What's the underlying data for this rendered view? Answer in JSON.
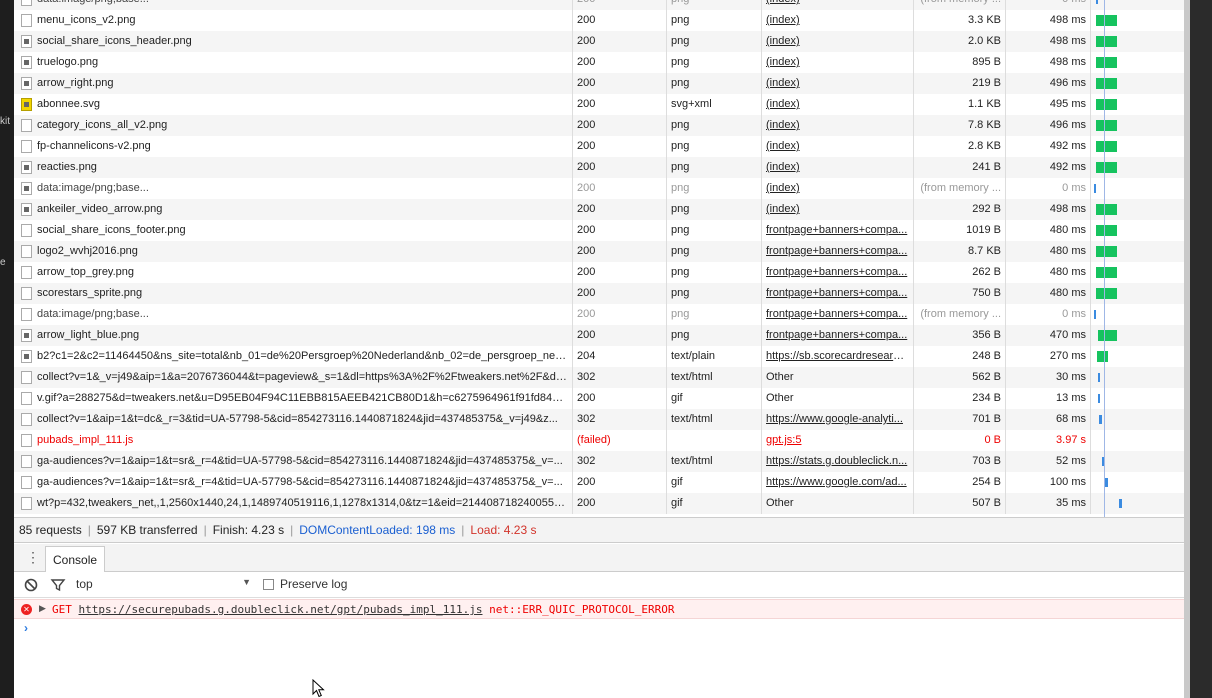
{
  "left_strip": {
    "text_1": "kit",
    "text_2": "e"
  },
  "requests": [
    {
      "name": "data:image/png;base...",
      "status": "200",
      "type": "png",
      "initiator": "(index)",
      "size": "(from memory ...",
      "time": "0 ms",
      "icon": "blank-file-icon",
      "dim": true,
      "wf_start": 5,
      "wf_width": 2
    },
    {
      "name": "menu_icons_v2.png",
      "status": "200",
      "type": "png",
      "initiator": "(index)",
      "size": "3.3 KB",
      "time": "498 ms",
      "icon": "blank-file-icon",
      "dim": false,
      "wf_start": 5,
      "wf_width": 21
    },
    {
      "name": "social_share_icons_header.png",
      "status": "200",
      "type": "png",
      "initiator": "(index)",
      "size": "2.0 KB",
      "time": "498 ms",
      "icon": "image-file-icon",
      "dim": false,
      "wf_start": 5,
      "wf_width": 21
    },
    {
      "name": "truelogo.png",
      "status": "200",
      "type": "png",
      "initiator": "(index)",
      "size": "895 B",
      "time": "498 ms",
      "icon": "image-file-icon",
      "dim": false,
      "wf_start": 5,
      "wf_width": 21
    },
    {
      "name": "arrow_right.png",
      "status": "200",
      "type": "png",
      "initiator": "(index)",
      "size": "219 B",
      "time": "496 ms",
      "icon": "arrow-file-icon",
      "dim": false,
      "wf_start": 5,
      "wf_width": 21
    },
    {
      "name": "abonnee.svg",
      "status": "200",
      "type": "svg+xml",
      "initiator": "(index)",
      "size": "1.1 KB",
      "time": "495 ms",
      "icon": "yellow-svg-icon",
      "dim": false,
      "wf_start": 5,
      "wf_width": 21
    },
    {
      "name": "category_icons_all_v2.png",
      "status": "200",
      "type": "png",
      "initiator": "(index)",
      "size": "7.8 KB",
      "time": "496 ms",
      "icon": "blank-file-icon",
      "dim": false,
      "wf_start": 5,
      "wf_width": 21
    },
    {
      "name": "fp-channelicons-v2.png",
      "status": "200",
      "type": "png",
      "initiator": "(index)",
      "size": "2.8 KB",
      "time": "492 ms",
      "icon": "blank-file-icon",
      "dim": false,
      "wf_start": 5,
      "wf_width": 21
    },
    {
      "name": "reacties.png",
      "status": "200",
      "type": "png",
      "initiator": "(index)",
      "size": "241 B",
      "time": "492 ms",
      "icon": "image-file-icon",
      "dim": false,
      "wf_start": 5,
      "wf_width": 21
    },
    {
      "name": "data:image/png;base...",
      "status": "200",
      "type": "png",
      "initiator": "(index)",
      "size": "(from memory ...",
      "time": "0 ms",
      "icon": "arrow-file-icon",
      "dim": true,
      "wf_start": 3,
      "wf_width": 2
    },
    {
      "name": "ankeiler_video_arrow.png",
      "status": "200",
      "type": "png",
      "initiator": "(index)",
      "size": "292 B",
      "time": "498 ms",
      "icon": "image-file-icon",
      "dim": false,
      "wf_start": 5,
      "wf_width": 21
    },
    {
      "name": "social_share_icons_footer.png",
      "status": "200",
      "type": "png",
      "initiator": "frontpage+banners+compa...",
      "size": "1019 B",
      "time": "480 ms",
      "icon": "blank-file-icon",
      "dim": false,
      "wf_start": 5,
      "wf_width": 21
    },
    {
      "name": "logo2_wvhj2016.png",
      "status": "200",
      "type": "png",
      "initiator": "frontpage+banners+compa...",
      "size": "8.7 KB",
      "time": "480 ms",
      "icon": "blank-file-icon",
      "dim": false,
      "wf_start": 5,
      "wf_width": 21
    },
    {
      "name": "arrow_top_grey.png",
      "status": "200",
      "type": "png",
      "initiator": "frontpage+banners+compa...",
      "size": "262 B",
      "time": "480 ms",
      "icon": "blank-file-icon",
      "dim": false,
      "wf_start": 5,
      "wf_width": 21
    },
    {
      "name": "scorestars_sprite.png",
      "status": "200",
      "type": "png",
      "initiator": "frontpage+banners+compa...",
      "size": "750 B",
      "time": "480 ms",
      "icon": "blank-file-icon",
      "dim": false,
      "wf_start": 5,
      "wf_width": 21
    },
    {
      "name": "data:image/png;base...",
      "status": "200",
      "type": "png",
      "initiator": "frontpage+banners+compa...",
      "size": "(from memory ...",
      "time": "0 ms",
      "icon": "blank-file-icon",
      "dim": true,
      "wf_start": 3,
      "wf_width": 2
    },
    {
      "name": "arrow_light_blue.png",
      "status": "200",
      "type": "png",
      "initiator": "frontpage+banners+compa...",
      "size": "356 B",
      "time": "470 ms",
      "icon": "arrow-file-icon",
      "dim": false,
      "wf_start": 7,
      "wf_width": 19
    },
    {
      "name": "b2?c1=2&c2=11464450&ns_site=total&nb_01=de%20Persgroep%20Nederland&nb_02=de_persgroep_ned...",
      "status": "204",
      "type": "text/plain",
      "initiator": "https://sb.scorecardresearch...",
      "size": "248 B",
      "time": "270 ms",
      "icon": "doc-file-icon",
      "dim": false,
      "wf_start": 6,
      "wf_width": 11
    },
    {
      "name": "collect?v=1&_v=j49&aip=1&a=2076736044&t=pageview&_s=1&dl=https%3A%2F%2Ftweakers.net%2F&dr...",
      "status": "302",
      "type": "text/html",
      "initiator": "Other",
      "size": "562 B",
      "time": "30 ms",
      "icon": "blank-file-icon",
      "dim": false,
      "wf_start": 7,
      "wf_width": 2
    },
    {
      "name": "v.gif?a=288275&d=tweakers.net&u=D95EB04F94C11EBB815AEEB421CB80D1&h=c6275964961f91fd849740...",
      "status": "200",
      "type": "gif",
      "initiator": "Other",
      "size": "234 B",
      "time": "13 ms",
      "icon": "blank-file-icon",
      "dim": false,
      "wf_start": 7,
      "wf_width": 2
    },
    {
      "name": "collect?v=1&aip=1&t=dc&_r=3&tid=UA-57798-5&cid=854273116.1440871824&jid=437485375&_v=j49&z...",
      "status": "302",
      "type": "text/html",
      "initiator": "https://www.google-analyti...",
      "size": "701 B",
      "time": "68 ms",
      "icon": "blank-file-icon",
      "dim": false,
      "wf_start": 8,
      "wf_width": 3
    },
    {
      "name": "pubads_impl_111.js",
      "status": "(failed)",
      "type": "",
      "initiator": "gpt.js:5",
      "size": "0 B",
      "time": "3.97 s",
      "icon": "blank-file-icon",
      "dim": false,
      "failed": true,
      "wf_start": 0,
      "wf_width": 0
    },
    {
      "name": "ga-audiences?v=1&aip=1&t=sr&_r=4&tid=UA-57798-5&cid=854273116.1440871824&jid=437485375&_v=...",
      "status": "302",
      "type": "text/html",
      "initiator": "https://stats.g.doubleclick.n...",
      "size": "703 B",
      "time": "52 ms",
      "icon": "blank-file-icon",
      "dim": false,
      "wf_start": 11,
      "wf_width": 3
    },
    {
      "name": "ga-audiences?v=1&aip=1&t=sr&_r=4&tid=UA-57798-5&cid=854273116.1440871824&jid=437485375&_v=...",
      "status": "200",
      "type": "gif",
      "initiator": "https://www.google.com/ad...",
      "size": "254 B",
      "time": "100 ms",
      "icon": "blank-file-icon",
      "dim": false,
      "wf_start": 13,
      "wf_width": 4
    },
    {
      "name": "wt?p=432,tweakers_net,,1,2560x1440,24,1,1489740519116,1,1278x1314,0&tz=1&eid=214408718240055571...",
      "status": "200",
      "type": "gif",
      "initiator": "Other",
      "size": "507 B",
      "time": "35 ms",
      "icon": "blank-file-icon",
      "dim": false,
      "wf_start": 28,
      "wf_width": 3
    }
  ],
  "summary": {
    "requests": "85 requests",
    "transferred": "597 KB transferred",
    "finish": "Finish: 4.23 s",
    "dcl": "DOMContentLoaded: 198 ms",
    "load": "Load: 4.23 s"
  },
  "drawer": {
    "menu": "⋮",
    "console_tab": "Console"
  },
  "console_toolbar": {
    "context": "top",
    "preserve_log": "Preserve log"
  },
  "error": {
    "method": "GET",
    "url": "https://securepubads.g.doubleclick.net/gpt/pubads_impl_111.js",
    "code": "net::ERR_QUIC_PROTOCOL_ERROR"
  },
  "prompt": "›",
  "colors": {
    "finished_bar": "#16c35f",
    "dcl_line": "#1a5fd1",
    "load_text": "#d2332a",
    "error_bg": "#fff0f0"
  }
}
